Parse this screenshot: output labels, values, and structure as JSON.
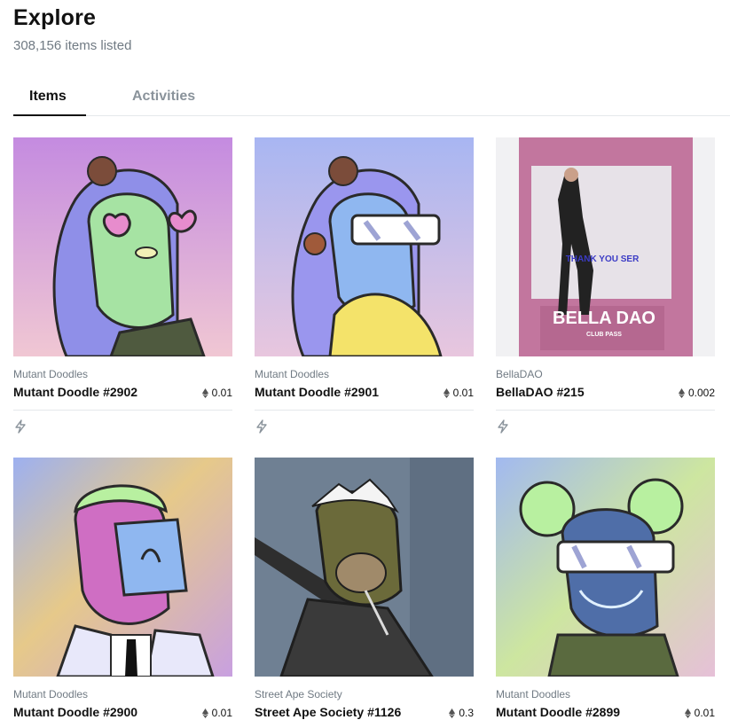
{
  "header": {
    "title": "Explore",
    "subtitle": "308,156 items listed"
  },
  "tabs": [
    {
      "label": "Items",
      "active": true
    },
    {
      "label": "Activities",
      "active": false
    }
  ],
  "cards": [
    {
      "collection": "Mutant Doodles",
      "name": "Mutant Doodle #2902",
      "price": "0.01"
    },
    {
      "collection": "Mutant Doodles",
      "name": "Mutant Doodle #2901",
      "price": "0.01"
    },
    {
      "collection": "BellaDAO",
      "name": "BellaDAO #215",
      "price": "0.002",
      "art": {
        "banner": "THANK YOU SER",
        "title": "BELLA DAO",
        "tagline": "CLUB PASS"
      }
    },
    {
      "collection": "Mutant Doodles",
      "name": "Mutant Doodle #2900",
      "price": "0.01"
    },
    {
      "collection": "Street Ape Society",
      "name": "Street Ape Society #1126",
      "price": "0.3"
    },
    {
      "collection": "Mutant Doodles",
      "name": "Mutant Doodle #2899",
      "price": "0.01"
    }
  ],
  "icons": {
    "price": "eth-icon",
    "action": "lightning-bolt-icon"
  },
  "colors": {
    "accent": "#111111",
    "muted": "#707a83",
    "divider": "#e5e8eb",
    "tab_inactive": "#8a939b"
  }
}
